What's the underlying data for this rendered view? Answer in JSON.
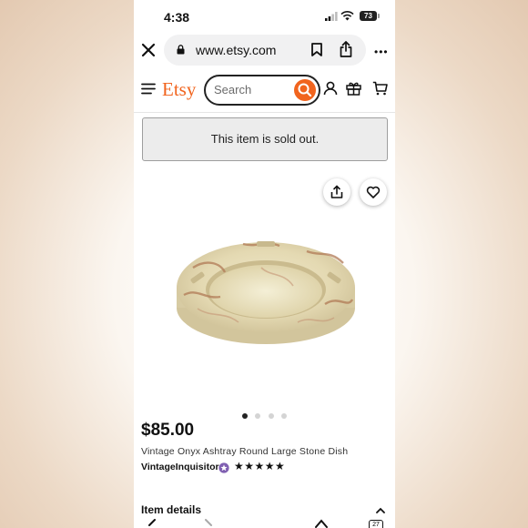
{
  "status_bar": {
    "time": "4:38",
    "battery": "73"
  },
  "browser": {
    "url": "www.etsy.com"
  },
  "header": {
    "logo": "Etsy",
    "search_placeholder": "Search"
  },
  "notice": {
    "text": "This item is sold out."
  },
  "carousel": {
    "image_count": 4,
    "active_index": 0
  },
  "listing": {
    "price": "$85.00",
    "title": "Vintage Onyx Ashtray Round Large Stone Dish",
    "seller": "VintageInquisitor",
    "rating_stars": "★★★★★",
    "rating": 5
  },
  "section": {
    "item_details": "Item details"
  },
  "toolbar": {
    "tab_count": "27"
  },
  "colors": {
    "etsy_orange": "#f1641e",
    "star_seller_purple": "#7f5fb1"
  }
}
